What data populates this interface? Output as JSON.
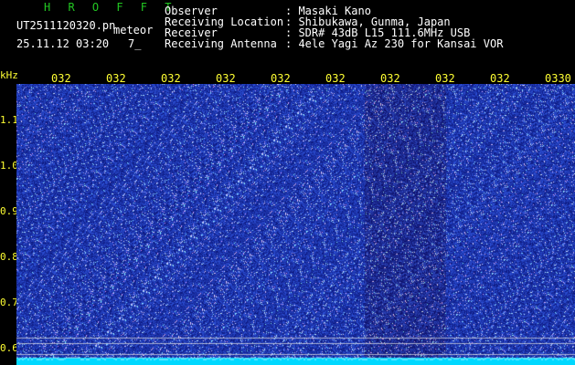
{
  "header": {
    "title": "H R O F F T",
    "filename": "UT2511120320.pn",
    "type_label": "meteor",
    "datetime": "25.11.12 03:20",
    "count": "7_",
    "fields": [
      {
        "label": "Observer",
        "value": ": Masaki Kano"
      },
      {
        "label": "Receiving Location",
        "value": ": Shibukawa, Gunma, Japan"
      },
      {
        "label": "Receiver",
        "value": ": SDR# 43dB L15 111.6MHz USB"
      },
      {
        "label": "Receiving Antenna",
        "value": ": 4ele Yagi Az 230 for Kansai VOR"
      }
    ]
  },
  "axes": {
    "unit": "kHz",
    "time_labels": [
      "032",
      "032",
      "032",
      "032",
      "032",
      "032",
      "032",
      "032",
      "032",
      "0330"
    ],
    "freq_labels": [
      "1.1",
      "1.0",
      "0.9",
      "0.8",
      "0.7",
      "0.6"
    ]
  },
  "colors": {
    "background": "#000000",
    "header_title": "#22c722",
    "labels": "#ffff33",
    "spectrum_bg": "#0a1a8c",
    "noise": "#3c64ff",
    "baseline": "#00d8ff"
  }
}
